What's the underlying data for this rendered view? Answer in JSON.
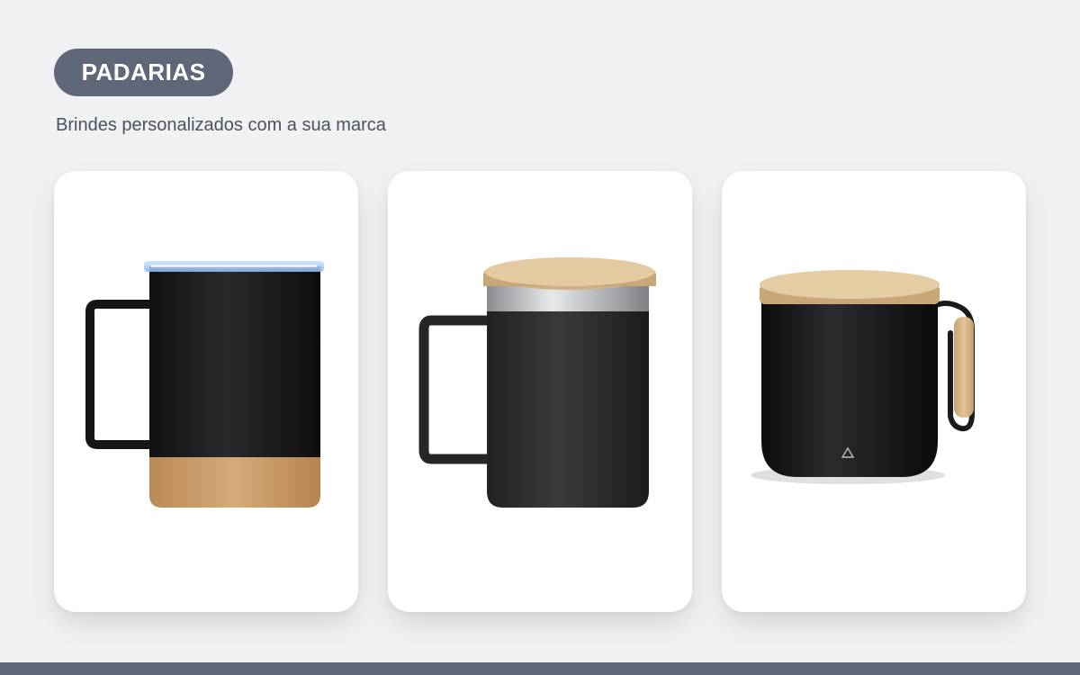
{
  "header": {
    "badge_label": "PADARIAS",
    "subtitle": "Brindes personalizados com a sua marca"
  },
  "products": [
    {
      "name": "mug-cork-base-clear-lid",
      "icon": "mug-icon"
    },
    {
      "name": "mug-steel-rim-bamboo-lid",
      "icon": "mug-icon"
    },
    {
      "name": "mug-bamboo-lid-wood-handle",
      "icon": "mug-icon"
    }
  ],
  "colors": {
    "background": "#f0f1f3",
    "badge": "#5f6878",
    "card": "#ffffff",
    "subtitle_text": "#4a5160",
    "mug_black": "#1c1c1e",
    "bamboo": "#d9b98a",
    "cork": "#c79a66"
  }
}
